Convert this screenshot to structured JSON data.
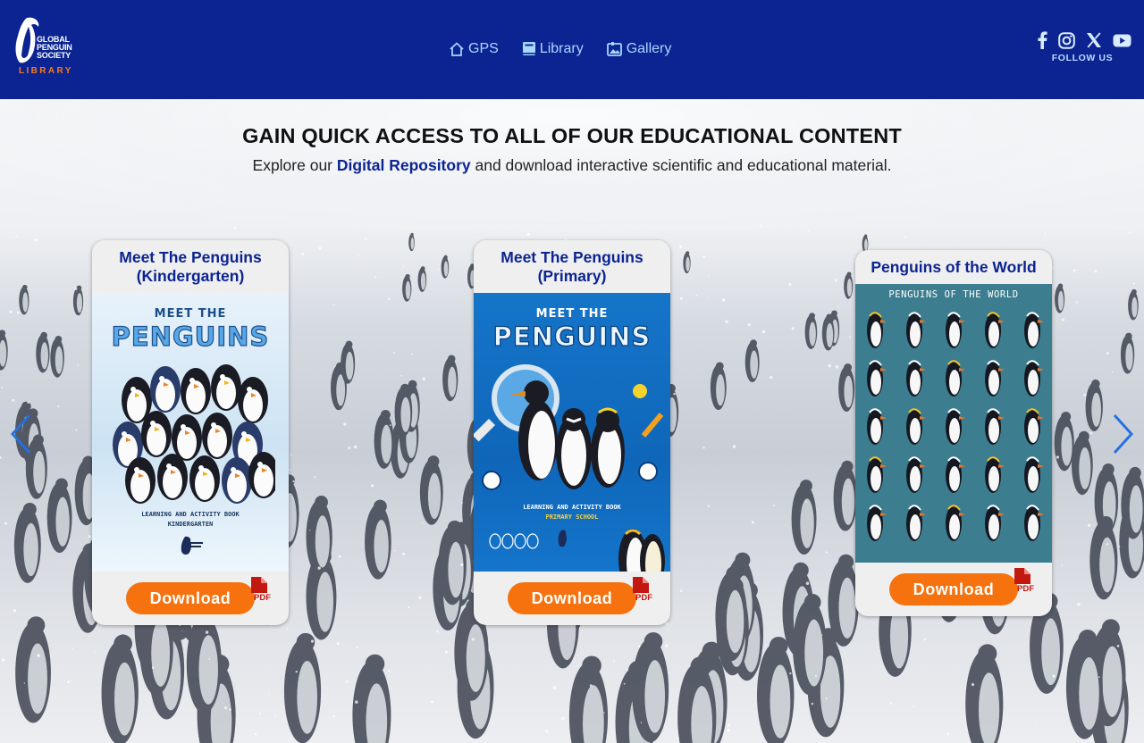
{
  "header": {
    "logo": {
      "line1": "GLOBAL",
      "line2": "PENGUIN",
      "line3": "SOCIETY",
      "sub": "LIBRARY"
    },
    "nav": [
      {
        "label": "GPS",
        "icon": "home-icon"
      },
      {
        "label": "Library",
        "icon": "book-icon"
      },
      {
        "label": "Gallery",
        "icon": "gallery-icon"
      }
    ],
    "social": {
      "icons": [
        "facebook-icon",
        "instagram-icon",
        "x-icon",
        "youtube-icon"
      ],
      "follow_label": "FOLLOW US"
    },
    "colors": {
      "background": "#0c2491",
      "nav_text": "#a9d6ff",
      "logo_accent": "#f47a20"
    }
  },
  "hero": {
    "headline": "GAIN QUICK ACCESS TO ALL OF OUR EDUCATIONAL CONTENT",
    "subline_prefix": "Explore our ",
    "subline_link": "Digital Repository",
    "subline_suffix": " and download interactive scientific and educational material."
  },
  "carousel": {
    "prev_icon": "chevron-left-icon",
    "next_icon": "chevron-right-icon",
    "cards": [
      {
        "title_line1": "Meet The Penguins",
        "title_line2": "(Kindergarten)",
        "cover_title1": "MEET THE",
        "cover_title2": "PENGUINS",
        "cover_caption1": "LEARNING AND ACTIVITY BOOK",
        "cover_caption2": "KINDERGARTEN",
        "download_label": "Download",
        "pdf_label": "PDF"
      },
      {
        "title_line1": "Meet The Penguins",
        "title_line2": "(Primary)",
        "cover_title1": "MEET THE",
        "cover_title2": "PENGUINS",
        "cover_caption1": "LEARNING AND ACTIVITY BOOK",
        "cover_caption2": "PRIMARY SCHOOL",
        "download_label": "Download",
        "pdf_label": "PDF"
      },
      {
        "title_line1": "Penguins of the World",
        "cover_title1": "PENGUINS OF THE WORLD",
        "download_label": "Download",
        "pdf_label": "PDF"
      }
    ],
    "colors": {
      "button": "#f5720f",
      "title": "#0c2491",
      "pdf": "#c3180f"
    }
  }
}
